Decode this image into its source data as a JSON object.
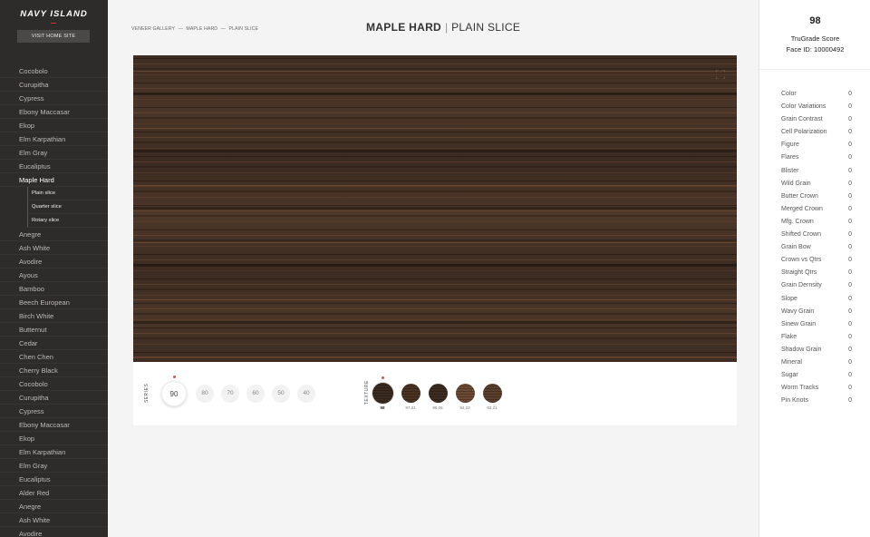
{
  "brand": {
    "name": "NAVY ISLAND",
    "visit_label": "VISIT HOME SITE"
  },
  "nav": {
    "top_items": [
      "Cocobolo",
      "Curupitha",
      "Cypress",
      "Ebony Maccasar",
      "Ekop",
      "Elm Karpathian",
      "Elm Gray",
      "Eucaliptus"
    ],
    "active_item": "Maple Hard",
    "sub_items": [
      "Plain slice",
      "Quarter slice",
      "Rotary slice"
    ],
    "bottom_items": [
      "Anegre",
      "Ash White",
      "Avodire",
      "Ayous",
      "Bamboo",
      "Beech European",
      "Birch White",
      "Butternut",
      "Cedar",
      "Chen Chen",
      "Cherry Black",
      "Cocobolo",
      "Curupitha",
      "Cypress",
      "Ebony Maccasar",
      "Ekop",
      "Elm Karpathian",
      "Elm Gray",
      "Eucaliptus",
      "Alder Red",
      "Anegre",
      "Ash White",
      "Avodire"
    ]
  },
  "breadcrumb": {
    "part1": "VENEER GALLERY",
    "sep1": "—",
    "part2": "MAPLE HARD",
    "sep2": "—",
    "part3": "PLAIN SLICE"
  },
  "title": {
    "species": "MAPLE HARD",
    "separator": "|",
    "cut": "PLAIN SLICE"
  },
  "series": {
    "label": "SERIES",
    "options": [
      "90",
      "80",
      "70",
      "60",
      "50",
      "40"
    ],
    "selected": "90"
  },
  "texture": {
    "label": "TEXTURE",
    "options": [
      {
        "label": "98",
        "color": "#3a2a20"
      },
      {
        "label": "97,31",
        "color": "#4a3322"
      },
      {
        "label": "95,06",
        "color": "#3d2c20"
      },
      {
        "label": "94,23",
        "color": "#6b4a33"
      },
      {
        "label": "93,21",
        "color": "#5a3f2c"
      }
    ],
    "selected": "98"
  },
  "score": {
    "value": "98",
    "label": "TruGrade Score",
    "face_id": "Face ID: 10000492"
  },
  "attributes": [
    {
      "name": "Color",
      "value": "0"
    },
    {
      "name": "Color Variations",
      "value": "0"
    },
    {
      "name": "Grain Contrast",
      "value": "0"
    },
    {
      "name": "Cell Polarization",
      "value": "0"
    },
    {
      "name": "Figure",
      "value": "0"
    },
    {
      "name": "Flares",
      "value": "0"
    },
    {
      "name": "Blister",
      "value": "0"
    },
    {
      "name": "Wild Grain",
      "value": "0"
    },
    {
      "name": "Butter Crown",
      "value": "0"
    },
    {
      "name": "Merged Crown",
      "value": "0"
    },
    {
      "name": "Mfg. Crown",
      "value": "0"
    },
    {
      "name": "Shifted Crown",
      "value": "0"
    },
    {
      "name": "Grain Bow",
      "value": "0"
    },
    {
      "name": "Crown vs Qtrs",
      "value": "0"
    },
    {
      "name": "Straight Qtrs",
      "value": "0"
    },
    {
      "name": "Grain Dernsity",
      "value": "0"
    },
    {
      "name": "Slope",
      "value": "0"
    },
    {
      "name": "Wavy Grain",
      "value": "0"
    },
    {
      "name": "Sinew Grain",
      "value": "0"
    },
    {
      "name": "Flake",
      "value": "0"
    },
    {
      "name": "Shadow Grain",
      "value": "0"
    },
    {
      "name": "Mineral",
      "value": "0"
    },
    {
      "name": "Sugar",
      "value": "0"
    },
    {
      "name": "Worm Tracks",
      "value": "0"
    },
    {
      "name": "Pin Knots",
      "value": "0"
    }
  ],
  "icons": {
    "expand": "expand-icon",
    "brand_accent": "#c0392b",
    "selected_dot": "#d9534f"
  }
}
